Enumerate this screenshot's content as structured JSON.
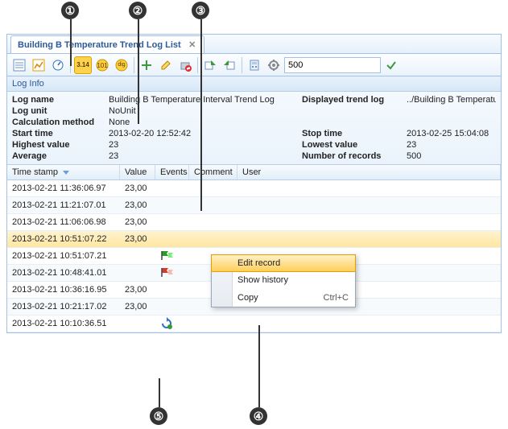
{
  "callouts": {
    "c1": "①",
    "c2": "②",
    "c3": "③",
    "c4": "④",
    "c5": "⑤"
  },
  "tab": {
    "title": "Building B Temperature Trend Log List"
  },
  "toolbar": {
    "number_input": "500",
    "pi_label": "3.14",
    "dig_label": "dig"
  },
  "section": {
    "log_info": "Log Info"
  },
  "info": {
    "log_name_lbl": "Log name",
    "log_name_val": "Building B Temperature Interval Trend Log",
    "displayed_lbl": "Displayed trend log",
    "displayed_val": "../Building B Temperature Interva",
    "log_unit_lbl": "Log unit",
    "log_unit_val": "NoUnit",
    "calc_lbl": "Calculation method",
    "calc_val": "None",
    "start_lbl": "Start time",
    "start_val": "2013-02-20 12:52:42",
    "stop_lbl": "Stop time",
    "stop_val": "2013-02-25 15:04:08",
    "high_lbl": "Highest value",
    "high_val": "23",
    "low_lbl": "Lowest value",
    "low_val": "23",
    "avg_lbl": "Average",
    "avg_val": "23",
    "num_lbl": "Number of records",
    "num_val": "500"
  },
  "columns": {
    "ts": "Time stamp",
    "val": "Value",
    "ev": "Events",
    "cm": "Comment",
    "us": "User"
  },
  "rows": [
    {
      "ts": "2013-02-21 11:36:06.97",
      "val": "23,00",
      "ev": ""
    },
    {
      "ts": "2013-02-21 11:21:07.01",
      "val": "23,00",
      "ev": ""
    },
    {
      "ts": "2013-02-21 11:06:06.98",
      "val": "23,00",
      "ev": ""
    },
    {
      "ts": "2013-02-21 10:51:07.22",
      "val": "23,00",
      "ev": ""
    },
    {
      "ts": "2013-02-21 10:51:07.21",
      "val": "",
      "ev": "flag-green"
    },
    {
      "ts": "2013-02-21 10:48:41.01",
      "val": "",
      "ev": "flag-red"
    },
    {
      "ts": "2013-02-21 10:36:16.95",
      "val": "23,00",
      "ev": ""
    },
    {
      "ts": "2013-02-21 10:21:17.02",
      "val": "23,00",
      "ev": ""
    },
    {
      "ts": "2013-02-21 10:10:36.51",
      "val": "",
      "ev": "refresh"
    }
  ],
  "ctx": {
    "edit": "Edit record",
    "history": "Show history",
    "copy": "Copy",
    "copy_sc": "Ctrl+C"
  }
}
